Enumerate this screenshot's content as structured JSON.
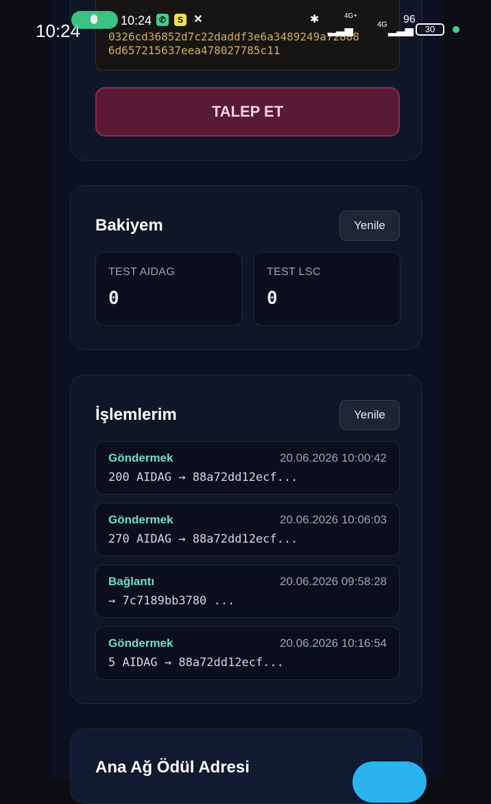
{
  "status_bar": {
    "clock_large": "10:24",
    "clock_small": "10:24",
    "battery_pct": "96",
    "battery_icon_text": "30",
    "network": "4G+",
    "network2": "4G"
  },
  "top_card": {
    "hash_line1": "0326cd36852d7c22daddf3e6a3489249a72888",
    "hash_line2": "6d657215637eea478027785c11",
    "claim_button": "TALEP ET"
  },
  "balance_card": {
    "title": "Bakiyem",
    "refresh": "Yenile",
    "items": [
      {
        "label": "TEST AIDAG",
        "value": "0"
      },
      {
        "label": "TEST LSC",
        "value": "0"
      }
    ]
  },
  "tx_card": {
    "title": "İşlemlerim",
    "refresh": "Yenile",
    "items": [
      {
        "type": "Göndermek",
        "time": "20.06.2026 10:00:42",
        "detail": "200 AIDAG → 88a72dd12ecf..."
      },
      {
        "type": "Göndermek",
        "time": "20.06.2026 10:06:03",
        "detail": "270 AIDAG → 88a72dd12ecf..."
      },
      {
        "type": "Bağlantı",
        "time": "20.06.2026 09:58:28",
        "detail": "→ 7c7189bb3780 ..."
      },
      {
        "type": "Göndermek",
        "time": "20.06.2026 10:16:54",
        "detail": "5 AIDAG → 88a72dd12ecf..."
      }
    ]
  },
  "reward_card": {
    "title": "Ana Ağ Ödül Adresi"
  },
  "colors": {
    "accent_teal": "#6fe0c6",
    "claim_bg": "#5a1a36",
    "hash_text": "#d6ad5a"
  }
}
